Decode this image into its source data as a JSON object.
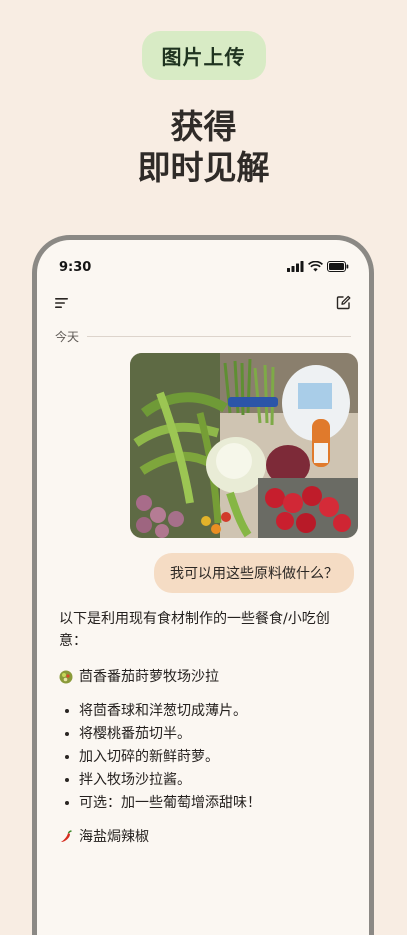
{
  "badge": "图片上传",
  "headline": [
    "获得",
    "即时见解"
  ],
  "status": {
    "time": "9:30"
  },
  "chat": {
    "day_label": "今天",
    "user_message": "我可以用这些原料做什么？",
    "reply_intro": "以下是利用现有食材制作的一些餐食/小吃创意：",
    "dish1": {
      "icon": "salad-icon",
      "title": "茴香番茄莳萝牧场沙拉",
      "steps": [
        "将茴香球和洋葱切成薄片。",
        "将樱桃番茄切半。",
        "加入切碎的新鲜莳萝。",
        "拌入牧场沙拉酱。",
        "可选：加一些葡萄增添甜味！"
      ]
    },
    "dish2": {
      "icon": "chili-pepper-icon",
      "title": "海盐焗辣椒"
    }
  },
  "colors": {
    "background": "#f8ede3",
    "badge": "#d8ebc5",
    "user_bubble": "#f5dcc4",
    "phone_frame": "#8b8985"
  }
}
